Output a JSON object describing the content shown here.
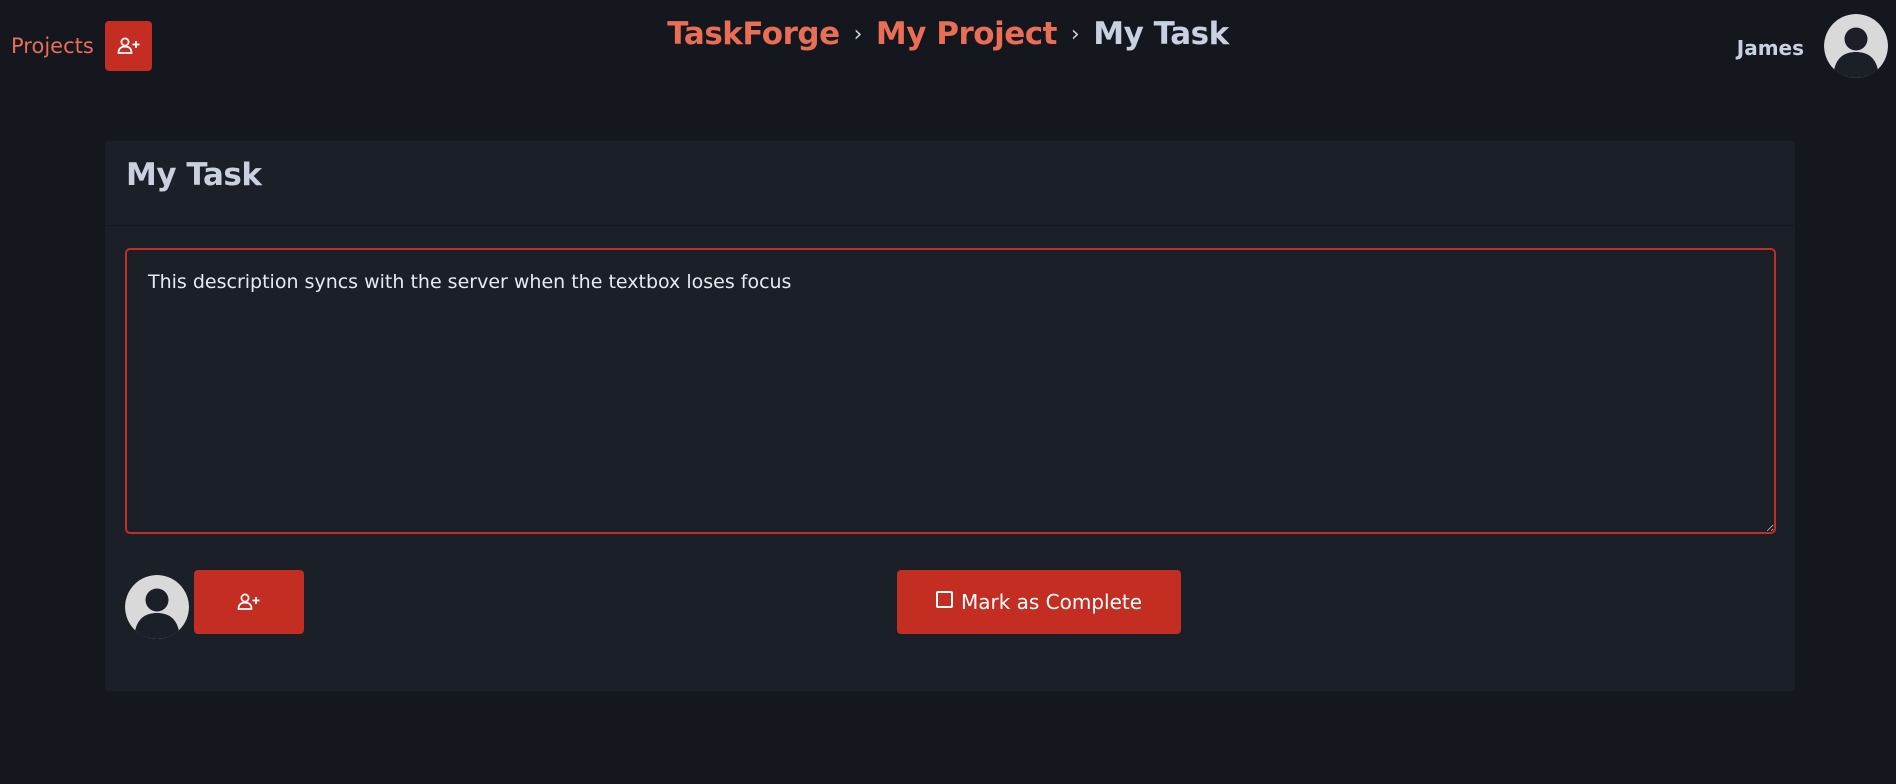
{
  "header": {
    "projects_link": "Projects",
    "breadcrumb": {
      "app": "TaskForge",
      "separator1": "›",
      "project": "My Project",
      "separator2": "›",
      "task": "My Task"
    },
    "user_name": "James"
  },
  "task": {
    "title": "My Task",
    "description": "This description syncs with the server when the textbox loses focus",
    "complete_label": "Mark as Complete"
  },
  "icons": {
    "top_button": "user-plus-icon",
    "assign_button": "user-plus-icon",
    "avatar": "user-avatar-icon",
    "complete_checkbox": "checkbox-empty-icon"
  },
  "colors": {
    "background": "#14171e",
    "card": "#1b1f27",
    "accent": "#c42d22",
    "link": "#ea6e55",
    "text": "#c9d1e0"
  }
}
